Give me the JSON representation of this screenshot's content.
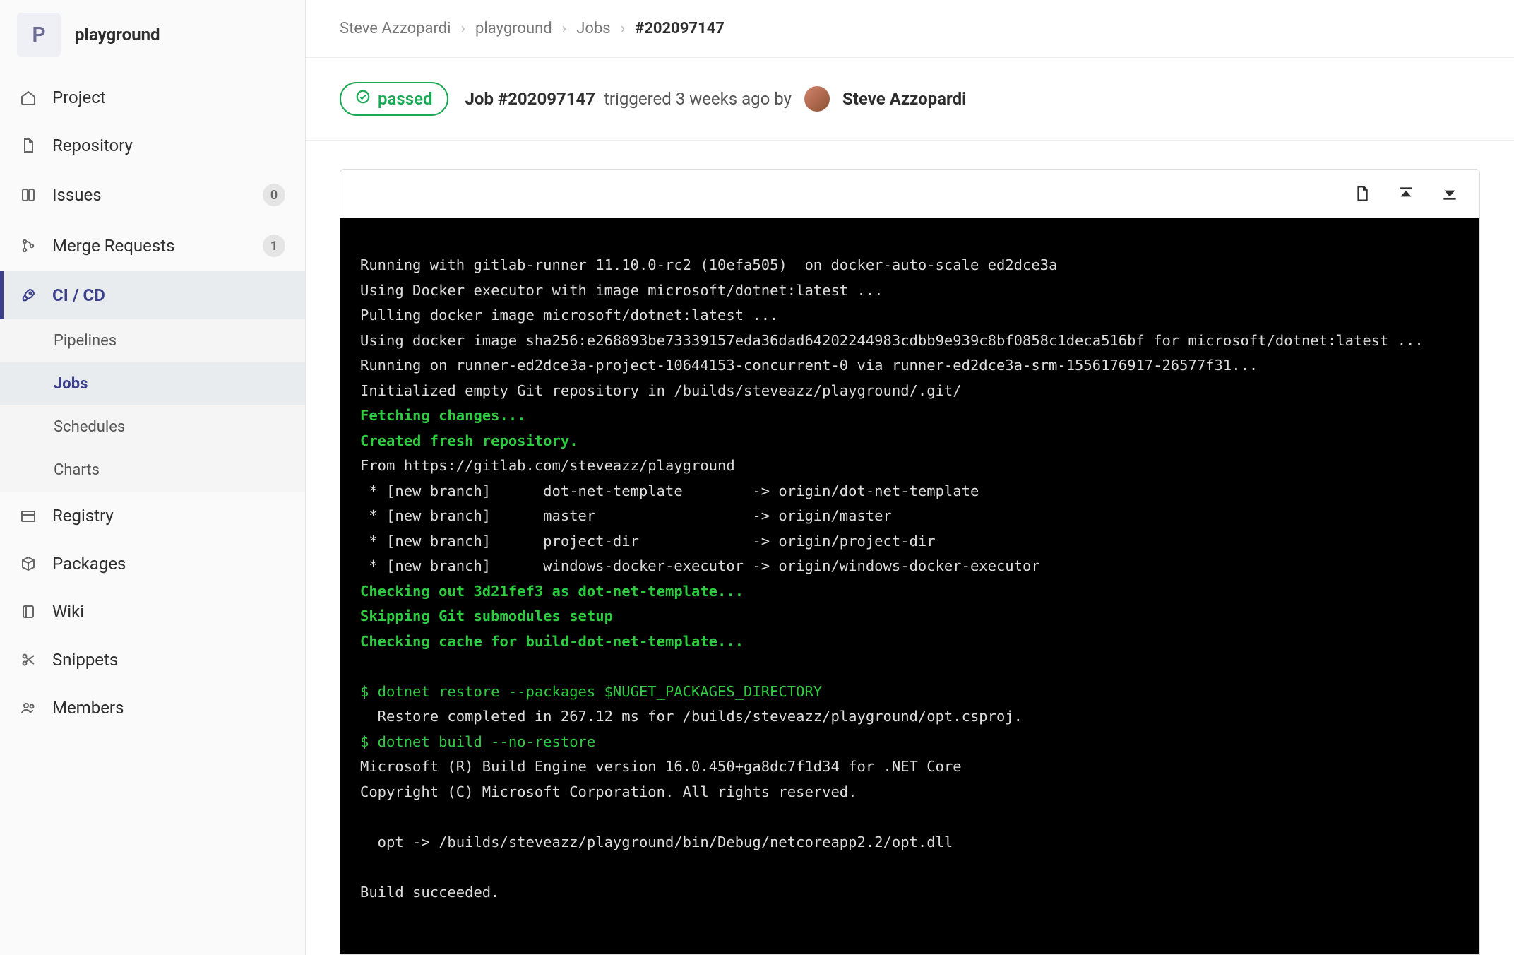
{
  "project": {
    "avatar_letter": "P",
    "name": "playground"
  },
  "sidebar": {
    "items": [
      {
        "label": "Project",
        "icon": "home"
      },
      {
        "label": "Repository",
        "icon": "file"
      },
      {
        "label": "Issues",
        "icon": "issues",
        "count": "0"
      },
      {
        "label": "Merge Requests",
        "icon": "merge",
        "count": "1"
      },
      {
        "label": "CI / CD",
        "icon": "rocket",
        "active": true,
        "sub": [
          {
            "label": "Pipelines"
          },
          {
            "label": "Jobs",
            "active": true
          },
          {
            "label": "Schedules"
          },
          {
            "label": "Charts"
          }
        ]
      },
      {
        "label": "Registry",
        "icon": "registry"
      },
      {
        "label": "Packages",
        "icon": "package"
      },
      {
        "label": "Wiki",
        "icon": "book"
      },
      {
        "label": "Snippets",
        "icon": "scissors"
      },
      {
        "label": "Members",
        "icon": "users"
      }
    ]
  },
  "breadcrumb": {
    "items": [
      "Steve Azzopardi",
      "playground",
      "Jobs",
      "#202097147"
    ]
  },
  "job": {
    "status": "passed",
    "title": "Job #202097147",
    "meta_triggered": "triggered 3 weeks ago by",
    "user": "Steve Azzopardi"
  },
  "log": {
    "lines": [
      {
        "t": "p",
        "text": "Running with gitlab-runner 11.10.0-rc2 (10efa505)  on docker-auto-scale ed2dce3a"
      },
      {
        "t": "p",
        "text": "Using Docker executor with image microsoft/dotnet:latest ..."
      },
      {
        "t": "p",
        "text": "Pulling docker image microsoft/dotnet:latest ..."
      },
      {
        "t": "p",
        "text": "Using docker image sha256:e268893be73339157eda36dad64202244983cdbb9e939c8bf0858c1deca516bf for microsoft/dotnet:latest ..."
      },
      {
        "t": "p",
        "text": "Running on runner-ed2dce3a-project-10644153-concurrent-0 via runner-ed2dce3a-srm-1556176917-26577f31..."
      },
      {
        "t": "p",
        "text": "Initialized empty Git repository in /builds/steveazz/playground/.git/"
      },
      {
        "t": "g",
        "text": "Fetching changes..."
      },
      {
        "t": "g",
        "text": "Created fresh repository."
      },
      {
        "t": "p",
        "text": "From https://gitlab.com/steveazz/playground"
      },
      {
        "t": "p",
        "text": " * [new branch]      dot-net-template        -> origin/dot-net-template"
      },
      {
        "t": "p",
        "text": " * [new branch]      master                  -> origin/master"
      },
      {
        "t": "p",
        "text": " * [new branch]      project-dir             -> origin/project-dir"
      },
      {
        "t": "p",
        "text": " * [new branch]      windows-docker-executor -> origin/windows-docker-executor"
      },
      {
        "t": "g",
        "text": "Checking out 3d21fef3 as dot-net-template..."
      },
      {
        "t": "g",
        "text": "Skipping Git submodules setup"
      },
      {
        "t": "g",
        "text": "Checking cache for build-dot-net-template..."
      },
      {
        "t": "b",
        "text": ""
      },
      {
        "t": "c",
        "text": "$ dotnet restore --packages $NUGET_PACKAGES_DIRECTORY"
      },
      {
        "t": "p",
        "text": "  Restore completed in 267.12 ms for /builds/steveazz/playground/opt.csproj."
      },
      {
        "t": "c",
        "text": "$ dotnet build --no-restore"
      },
      {
        "t": "p",
        "text": "Microsoft (R) Build Engine version 16.0.450+ga8dc7f1d34 for .NET Core"
      },
      {
        "t": "p",
        "text": "Copyright (C) Microsoft Corporation. All rights reserved."
      },
      {
        "t": "b",
        "text": ""
      },
      {
        "t": "p",
        "text": "  opt -> /builds/steveazz/playground/bin/Debug/netcoreapp2.2/opt.dll"
      },
      {
        "t": "b",
        "text": ""
      },
      {
        "t": "p",
        "text": "Build succeeded."
      }
    ]
  }
}
